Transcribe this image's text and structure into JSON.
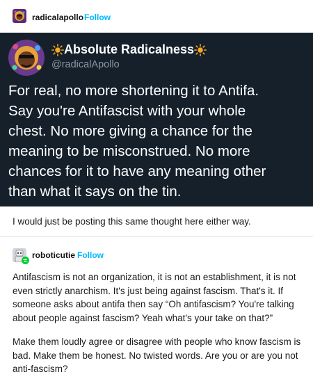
{
  "reblogs": [
    {
      "username": "radicalapollo",
      "follow_label": "Follow"
    },
    {
      "username": "roboticutie",
      "follow_label": "Follow"
    }
  ],
  "tweet": {
    "display_name": "Absolute Radicalness",
    "handle": "@radicalApollo",
    "text_lines": [
      "For real, no more shortening it to Antifa.",
      "Say you're Antifascist with your whole",
      "chest. No more giving a chance for the",
      "meaning to be misconstrued. No more",
      "chances for it to have any meaning other",
      "than what it says on the tin."
    ]
  },
  "comment": "I would just be posting this same thought here either way.",
  "reply": {
    "paragraph1_lines": [
      "Antifascism is not an organization, it is not an establishment, it is not",
      "even strictly anarchism. It's just being against fascism. That's it. If",
      "someone asks about antifa then say “Oh antifascism? You're talking",
      "about people against fascism? Yeah what's your take on that?”"
    ],
    "paragraph2_lines": [
      "Make them loudly agree or disagree with people who know fascism is",
      "bad. Make them be honest. No twisted words. Are you or are you not",
      "anti-fascism?"
    ]
  },
  "colors": {
    "follow": "#00b8ff",
    "tweet_background": "#15202b",
    "tweet_handle": "#8b98a5",
    "sun": "#f5a623"
  },
  "icons": {
    "tweet_name_prefix": "sun-icon",
    "tweet_name_suffix": "sun-icon",
    "reblog_badge": "reblog-badge-icon"
  }
}
